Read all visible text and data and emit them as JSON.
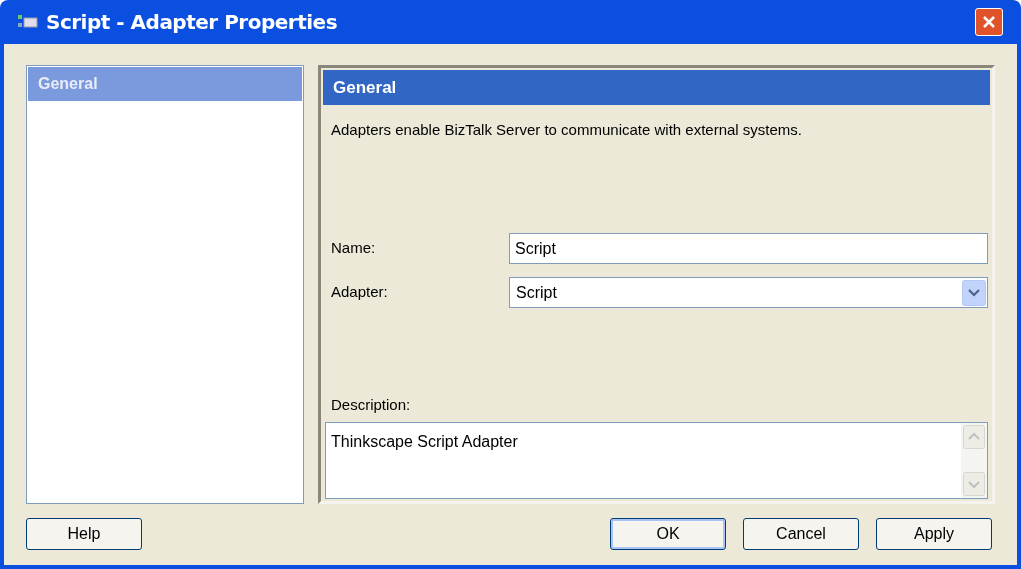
{
  "window": {
    "title": "Script - Adapter Properties"
  },
  "sidebar": {
    "items": [
      {
        "label": "General",
        "selected": true
      }
    ]
  },
  "panel": {
    "header": "General",
    "description_text": "Adapters enable BizTalk Server to communicate with external systems.",
    "name_field": {
      "label": "Name:",
      "value": "Script"
    },
    "adapter_field": {
      "label": "Adapter:",
      "value": "Script"
    },
    "description_field": {
      "label": "Description:",
      "value": "Thinkscape Script Adapter"
    }
  },
  "buttons": [
    {
      "label": "Help",
      "kind": "left",
      "default": false
    },
    {
      "label": "OK",
      "kind": "right",
      "default": true
    },
    {
      "label": "Cancel",
      "kind": "right",
      "default": false
    },
    {
      "label": "Apply",
      "kind": "right",
      "default": false
    }
  ]
}
